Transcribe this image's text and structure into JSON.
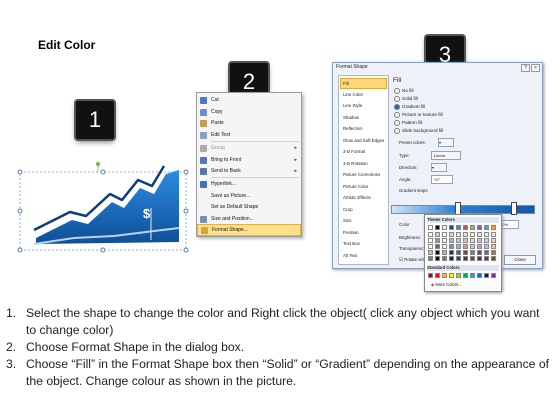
{
  "heading": "Edit Color",
  "steps": [
    "1",
    "2",
    "3"
  ],
  "chart_sign": "$",
  "context_menu": {
    "items": [
      {
        "label": "Cut",
        "color": "#4d79c4"
      },
      {
        "label": "Copy",
        "color": "#6d8fcb"
      },
      {
        "label": "Paste",
        "color": "#c79b4b"
      },
      {
        "label": "Edit Text",
        "color": "#8ba0c2"
      },
      {
        "label": "Group",
        "color": "#aaaaaa",
        "disabled": true,
        "submenu": true
      },
      {
        "label": "Bring to Front",
        "color": "#5577aa",
        "submenu": true
      },
      {
        "label": "Send to Back",
        "color": "#5577aa",
        "submenu": true
      },
      {
        "label": "Hyperlink...",
        "color": "#3b74b8"
      },
      {
        "label": "Save as Picture...",
        "color": ""
      },
      {
        "label": "Set as Default Shape",
        "color": ""
      },
      {
        "label": "Size and Position...",
        "color": "#7b8fb0"
      },
      {
        "label": "Format Shape...",
        "color": "#d6a23a",
        "highlighted": true
      }
    ]
  },
  "dialog": {
    "title": "Format Shape",
    "nav": [
      "Fill",
      "Line Color",
      "Line Style",
      "Shadow",
      "Reflection",
      "Glow and Soft Edges",
      "3-D Format",
      "3-D Rotation",
      "Picture Corrections",
      "Picture Color",
      "Artistic Effects",
      "Crop",
      "Size",
      "Position",
      "Text Box",
      "Alt Text"
    ],
    "fill_heading": "Fill",
    "fill_options": [
      {
        "label": "No fill",
        "selected": false
      },
      {
        "label": "Solid fill",
        "selected": false
      },
      {
        "label": "Gradient fill",
        "selected": true
      },
      {
        "label": "Picture or texture fill",
        "selected": false
      },
      {
        "label": "Pattern fill",
        "selected": false
      },
      {
        "label": "Slide background fill",
        "selected": false
      }
    ],
    "preset_colors_label": "Preset colors:",
    "type_label": "Type:",
    "type_value": "Linear",
    "direction_label": "Direction:",
    "angle_label": "Angle:",
    "angle_value": "70°",
    "gradient_stops_label": "Gradient stops",
    "color_label": "Color",
    "position_label": "Position:",
    "position_value": "30%",
    "brightness_label": "Brightness:",
    "transparency_label": "Transparency:",
    "rotate_label": "Rotate with shape",
    "close_label": "Close"
  },
  "palette": {
    "theme_label": "Theme Colors",
    "standard_label": "Standard Colors",
    "more_label": "More Colors...",
    "theme_top": [
      "#ffffff",
      "#000000",
      "#eeece1",
      "#1f497d",
      "#4f81bd",
      "#c0504d",
      "#9bbb59",
      "#8064a2",
      "#4bacc6",
      "#f79646"
    ],
    "standard": [
      "#c00000",
      "#ff0000",
      "#ffc000",
      "#ffff00",
      "#92d050",
      "#00b050",
      "#00b0f0",
      "#0070c0",
      "#002060",
      "#7030a0"
    ]
  },
  "instructions": [
    {
      "num": "1.",
      "text": "Select the shape to change the color and Right click the object( click any object which you want to change color)"
    },
    {
      "num": "2.",
      "text": "Choose Format Shape in the dialog box."
    },
    {
      "num": "3.",
      "text": "Choose “Fill” in the Format Shape box then “Solid” or “Gradient” depending on the appearance of the object. Change colour as shown in the picture."
    }
  ]
}
